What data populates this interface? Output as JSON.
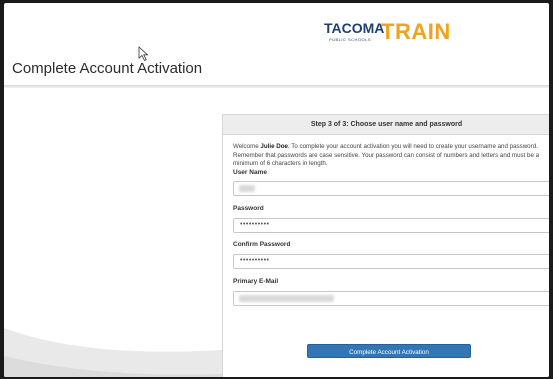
{
  "page": {
    "title": "Complete Account Activation"
  },
  "logo": {
    "org": "TACOMA",
    "org_sub": "PUBLIC SCHOOLS",
    "org_tagline": "",
    "product": "TRAIN"
  },
  "panel": {
    "header": "Step 3 of 3: Choose user name and password",
    "intro_prefix": "Welcome ",
    "intro_name": "Julie Doe",
    "intro_text": ". To complete your account activation you will need to create your username and password. Remember that passwords are case sensitive. Your password can consist of numbers and letters and must be a minimum of 6 characters in length.",
    "fields": {
      "username_label": "User Name",
      "password_label": "Password",
      "password_value": "••••••••••",
      "confirm_label": "Confirm Password",
      "confirm_value": "••••••••••",
      "email_label": "Primary E-Mail"
    },
    "submit_label": "Complete Account Activation"
  },
  "colors": {
    "button": "#3475b4",
    "logo_navy": "#1f3f73",
    "logo_orange": "#f0a31c"
  }
}
